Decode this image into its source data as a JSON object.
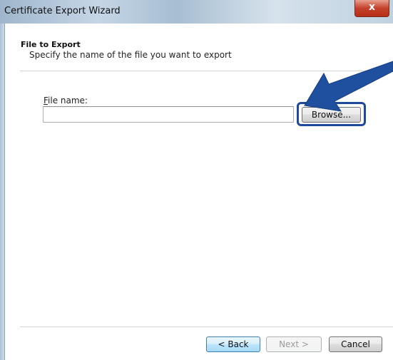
{
  "window": {
    "title": "Certificate Export Wizard",
    "close_label": "x"
  },
  "header": {
    "title": "File to Export",
    "subtitle": "Specify the name of the file you want to export"
  },
  "form": {
    "file_name_label_accel": "F",
    "file_name_label_rest": "ile name:",
    "file_name_value": ""
  },
  "buttons": {
    "browse": "Browse...",
    "back": "< Back",
    "next": "Next >",
    "cancel": "Cancel"
  },
  "colors": {
    "highlight": "#1e4a9c",
    "arrow": "#1f4f9f"
  },
  "icons": {
    "close": "close-icon",
    "annotation": "arrow-pointer-icon"
  }
}
